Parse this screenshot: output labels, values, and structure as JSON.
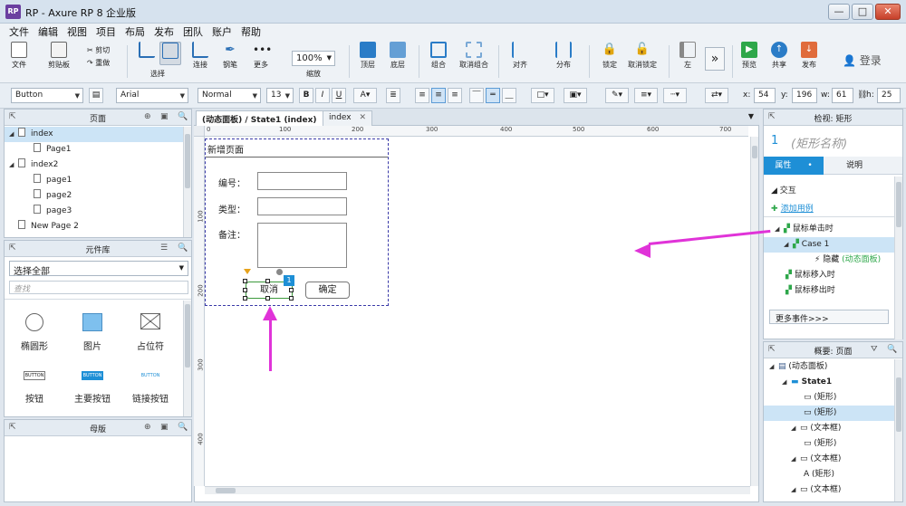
{
  "window": {
    "logo_text": "RP",
    "title": "RP - Axure RP 8 企业版",
    "min_label": "—",
    "max_label": "□",
    "close_label": "✕"
  },
  "menu": [
    "文件",
    "编辑",
    "视图",
    "项目",
    "布局",
    "发布",
    "团队",
    "账户",
    "帮助"
  ],
  "toolbar": {
    "file_label": "文件",
    "clipboard_label": "剪贴板",
    "cut_label": "剪切",
    "redo_label": "重做",
    "select_label": "选择",
    "connect_label": "连接",
    "pen_label": "钢笔",
    "more_label": "更多",
    "zoom_value": "100%",
    "zoom_label": "缩放",
    "top_label": "顶层",
    "bottom_label": "底层",
    "group_label": "组合",
    "ungroup_label": "取消组合",
    "align_label": "对齐",
    "distribute_label": "分布",
    "lock_label": "锁定",
    "unlock_label": "取消锁定",
    "left_label": "左",
    "expand_label": "»",
    "preview_label": "预览",
    "share_label": "共享",
    "publish_label": "发布",
    "login_label": "登录"
  },
  "format": {
    "style": "Button",
    "font": "Arial",
    "weight": "Normal",
    "size": "13",
    "bold": "B",
    "italic": "I",
    "underline": "U",
    "x_label": "x:",
    "x_value": "54",
    "y_label": "y:",
    "y_value": "196",
    "w_label": "w:",
    "w_value": "61",
    "h_label": "h:",
    "h_value": "25"
  },
  "pages_panel": {
    "title": "页面",
    "items": [
      {
        "label": "index",
        "level": 0,
        "expanded": true,
        "selected": true
      },
      {
        "label": "Page1",
        "level": 1
      },
      {
        "label": "index2",
        "level": 0,
        "expanded": true
      },
      {
        "label": "page1",
        "level": 1
      },
      {
        "label": "page2",
        "level": 1
      },
      {
        "label": "page3",
        "level": 1
      },
      {
        "label": "New Page 2",
        "level": 0
      }
    ]
  },
  "widget_panel": {
    "title": "元件库",
    "library": "选择全部",
    "search_placeholder": "查找",
    "widgets": [
      {
        "label": "椭圆形",
        "icon": "ellipse-icon"
      },
      {
        "label": "图片",
        "icon": "image-icon"
      },
      {
        "label": "占位符",
        "icon": "placeholder-icon"
      },
      {
        "label": "按钮",
        "icon": "button-icon",
        "text": "BUTTON"
      },
      {
        "label": "主要按钮",
        "icon": "primary-button-icon",
        "text": "BUTTON"
      },
      {
        "label": "链接按钮",
        "icon": "link-button-icon",
        "text": "BUTTON"
      }
    ]
  },
  "masters_panel": {
    "title": "母版"
  },
  "tabs": [
    {
      "label": "(动态面板) / State1 (index)",
      "active": true
    },
    {
      "label": "index",
      "active": false
    }
  ],
  "ruler": {
    "top": [
      "0",
      "100",
      "200",
      "300",
      "400",
      "500",
      "600",
      "700"
    ],
    "left": [
      "100",
      "200",
      "300",
      "400"
    ]
  },
  "form": {
    "title": "新增页面",
    "fields": [
      "编号：",
      "类型：",
      "备注："
    ],
    "cancel": "取消",
    "confirm": "确定",
    "badge": "1"
  },
  "inspector": {
    "title": "检视: 矩形",
    "name_index": "1",
    "name_placeholder": "(矩形名称)",
    "tab_props": "属性",
    "tab_notes": "说明",
    "section": "交互",
    "add_case": "添加用例",
    "events": [
      {
        "label": "鼠标单击时",
        "level": 0
      },
      {
        "label": "Case 1",
        "level": 1,
        "selected": true
      },
      {
        "label": "隐藏",
        "level": 2,
        "detail": "(动态面板)"
      },
      {
        "label": "鼠标移入时",
        "level": 0
      },
      {
        "label": "鼠标移出时",
        "level": 0
      }
    ],
    "more_events": "更多事件>>>"
  },
  "outline": {
    "title": "概要: 页面",
    "items": [
      {
        "label": "(动态面板)",
        "level": 0
      },
      {
        "label": "State1",
        "level": 1,
        "bold": true
      },
      {
        "label": "(矩形)",
        "level": 2
      },
      {
        "label": "(矩形)",
        "level": 2,
        "selected": true
      },
      {
        "label": "(文本框)",
        "level": 2
      },
      {
        "label": "(矩形)",
        "level": 2
      },
      {
        "label": "(文本框)",
        "level": 2
      },
      {
        "label": "(矩形)",
        "level": 2
      },
      {
        "label": "(文本框)",
        "level": 2
      }
    ]
  },
  "colors": {
    "accent": "#1e8fd6",
    "annotation": "#e033d8",
    "selection": "#cce4f6",
    "panel_border": "#3a3aa8"
  }
}
